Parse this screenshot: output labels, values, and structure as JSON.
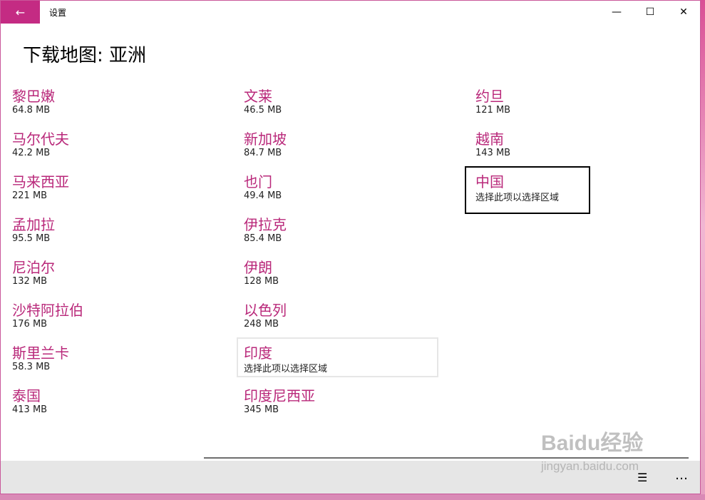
{
  "window": {
    "title": "设置",
    "back_icon": "←",
    "minimize_icon": "—",
    "maximize_icon": "☐",
    "close_icon": "✕"
  },
  "page_title": "下载地图: 亚洲",
  "columns": [
    [
      {
        "name": "黎巴嫩",
        "size": "64.8 MB"
      },
      {
        "name": "马尔代夫",
        "size": "42.2 MB"
      },
      {
        "name": "马来西亚",
        "size": "221 MB"
      },
      {
        "name": "孟加拉",
        "size": "95.5 MB"
      },
      {
        "name": "尼泊尔",
        "size": "132 MB"
      },
      {
        "name": "沙特阿拉伯",
        "size": "176 MB"
      },
      {
        "name": "斯里兰卡",
        "size": "58.3 MB"
      },
      {
        "name": "泰国",
        "size": "413 MB"
      }
    ],
    [
      {
        "name": "文莱",
        "size": "46.5 MB"
      },
      {
        "name": "新加坡",
        "size": "84.7 MB"
      },
      {
        "name": "也门",
        "size": "49.4 MB"
      },
      {
        "name": "伊拉克",
        "size": "85.4 MB"
      },
      {
        "name": "伊朗",
        "size": "128 MB"
      },
      {
        "name": "以色列",
        "size": "248 MB"
      },
      {
        "name": "印度",
        "size": "选择此项以选择区域"
      },
      {
        "name": "印度尼西亚",
        "size": "345 MB"
      }
    ],
    [
      {
        "name": "约旦",
        "size": "121 MB"
      },
      {
        "name": "越南",
        "size": "143 MB"
      },
      {
        "name": "中国",
        "size": "选择此项以选择区域"
      }
    ]
  ],
  "bottom_bar": {
    "list_icon": "☰",
    "more_icon": "…"
  },
  "watermark": {
    "logo": "Baidu经验",
    "url": "jingyan.baidu.com"
  },
  "colors": {
    "accent": "#c42b83",
    "item_name": "#b9287a"
  }
}
